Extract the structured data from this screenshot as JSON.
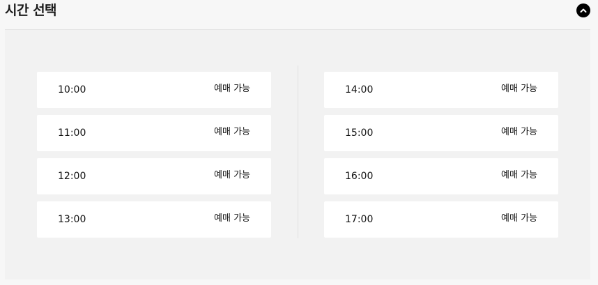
{
  "header": {
    "title": "시간 선택",
    "collapse_icon": "chevron-up-icon"
  },
  "slots": {
    "left": [
      {
        "time": "10:00",
        "status": "예매 가능"
      },
      {
        "time": "11:00",
        "status": "예매 가능"
      },
      {
        "time": "12:00",
        "status": "예매 가능"
      },
      {
        "time": "13:00",
        "status": "예매 가능"
      }
    ],
    "right": [
      {
        "time": "14:00",
        "status": "예매 가능"
      },
      {
        "time": "15:00",
        "status": "예매 가능"
      },
      {
        "time": "16:00",
        "status": "예매 가능"
      },
      {
        "time": "17:00",
        "status": "예매 가능"
      }
    ]
  },
  "colors": {
    "panel_bg": "#f2f2f2",
    "slot_bg": "#ffffff",
    "button_bg": "#000000"
  }
}
